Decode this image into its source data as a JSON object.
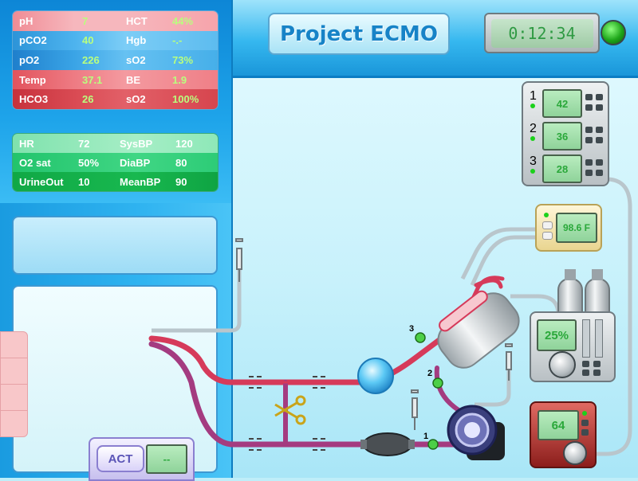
{
  "app": {
    "title": "Project ECMO",
    "timer": "0:12:34"
  },
  "labs": {
    "rows": [
      {
        "l1": "pH",
        "v1": "7",
        "l2": "HCT",
        "v2": "44%",
        "tone": "pink"
      },
      {
        "l1": "pCO2",
        "v1": "40",
        "l2": "Hgb",
        "v2": "-.-",
        "tone": "blue"
      },
      {
        "l1": "pO2",
        "v1": "226",
        "l2": "sO2",
        "v2": "73%",
        "tone": "blue"
      },
      {
        "l1": "Temp",
        "v1": "37.1",
        "l2": "BE",
        "v2": "1.9",
        "tone": "red"
      },
      {
        "l1": "HCO3",
        "v1": "26",
        "l2": "sO2",
        "v2": "100%",
        "tone": "red"
      }
    ]
  },
  "vitals": {
    "rows": [
      {
        "l1": "HR",
        "v1": "72",
        "l2": "SysBP",
        "v2": "120"
      },
      {
        "l1": "O2 sat",
        "v1": "50%",
        "l2": "DiaBP",
        "v2": "80"
      },
      {
        "l1": "UrineOut",
        "v1": "10",
        "l2": "MeanBP",
        "v2": "90"
      }
    ]
  },
  "monitors": {
    "pumps": [
      {
        "index": "1",
        "value": "42"
      },
      {
        "index": "2",
        "value": "36"
      },
      {
        "index": "3",
        "value": "28"
      }
    ],
    "heater": "98.6 F",
    "gas_blender": "25%",
    "pump_console": "64"
  },
  "circuit_ports": {
    "p1": "1",
    "p2": "2",
    "p3": "3"
  },
  "act": {
    "label": "ACT",
    "value": "--"
  },
  "colors": {
    "arterial": "#d63a5a",
    "venous": "#a43b80",
    "status_led": "#1ea61a",
    "lcd_text": "#2aa83a"
  },
  "icons": [
    "syringe-icon",
    "clamp-scissors-icon",
    "oxygenator-icon",
    "pump-head-icon",
    "gas-cylinder-icon",
    "bubble-trap-icon"
  ]
}
